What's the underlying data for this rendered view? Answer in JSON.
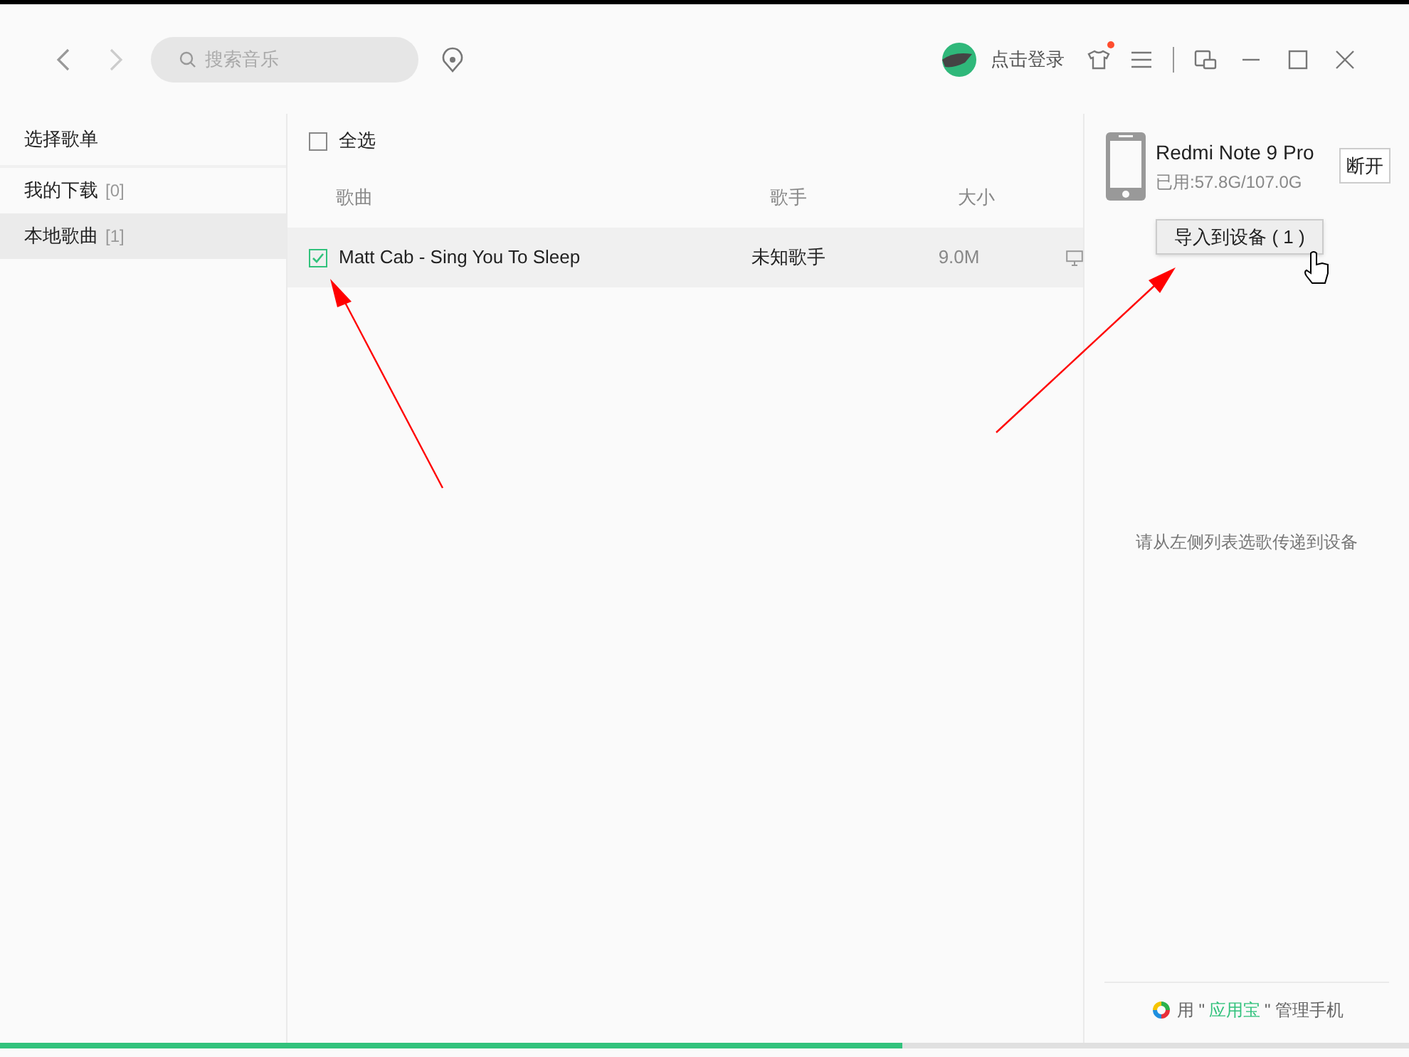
{
  "toolbar": {
    "search_placeholder": "搜索音乐",
    "login": "点击登录",
    "skin_badge": true
  },
  "sidebar": {
    "title": "选择歌单",
    "items": [
      {
        "label": "我的下载",
        "count": "[0]",
        "selected": false
      },
      {
        "label": "本地歌曲",
        "count": "[1]",
        "selected": true
      }
    ]
  },
  "song_list": {
    "select_all": {
      "label": "全选",
      "checked": false
    },
    "columns": [
      "歌曲",
      "歌手",
      "大小"
    ],
    "rows": [
      {
        "title": "Matt Cab - Sing You To Sleep",
        "artist": "未知歌手",
        "size": "9.0M",
        "checked": true
      }
    ]
  },
  "device": {
    "name": "Redmi Note 9 Pro",
    "usage": "已用:57.8G/107.0G",
    "disconnect": "断开",
    "import_button": "导入到设备 ( 1 )",
    "hint": "请从左侧列表选歌传递到设备",
    "footer": {
      "before": "用 \"",
      "app": "应用宝",
      "after": "\" 管理手机"
    }
  },
  "progress": {
    "level": 0.64
  }
}
